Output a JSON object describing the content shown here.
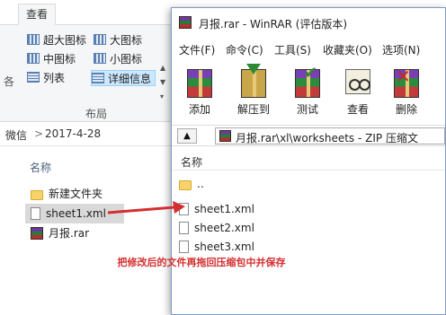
{
  "explorer": {
    "tab_view": "查看",
    "layout": {
      "extra_large_icons": "超大图标",
      "large_icons": "大图标",
      "medium_icons": "中图标",
      "small_icons": "小图标",
      "list": "列表",
      "details": "详细信息",
      "group_label": "布局"
    },
    "address": {
      "crumb1": "微信",
      "separator": ">",
      "crumb2": "2017-4-28"
    },
    "name_header": "名称",
    "files": [
      {
        "name": "新建文件夹",
        "icon": "folder-icon"
      },
      {
        "name": "sheet1.xml",
        "icon": "xml-file-icon"
      },
      {
        "name": "月报.rar",
        "icon": "winrar-archive-icon"
      }
    ],
    "partial_left_label": "各"
  },
  "winrar": {
    "title": "月报.rar - WinRAR (评估版本)",
    "menu": [
      "文件(F)",
      "命令(C)",
      "工具(S)",
      "收藏夹(O)",
      "选项(N)"
    ],
    "toolbar": [
      "添加",
      "解压到",
      "测试",
      "查看",
      "删除"
    ],
    "path": "月报.rar\\xl\\worksheets - ZIP 压缩文",
    "name_header": "名称",
    "entries": [
      "..",
      "sheet1.xml",
      "sheet2.xml",
      "sheet3.xml"
    ]
  },
  "annotation": {
    "text": "把修改后的文件再拖回压缩包中并保存",
    "color": "#d32f2f"
  }
}
